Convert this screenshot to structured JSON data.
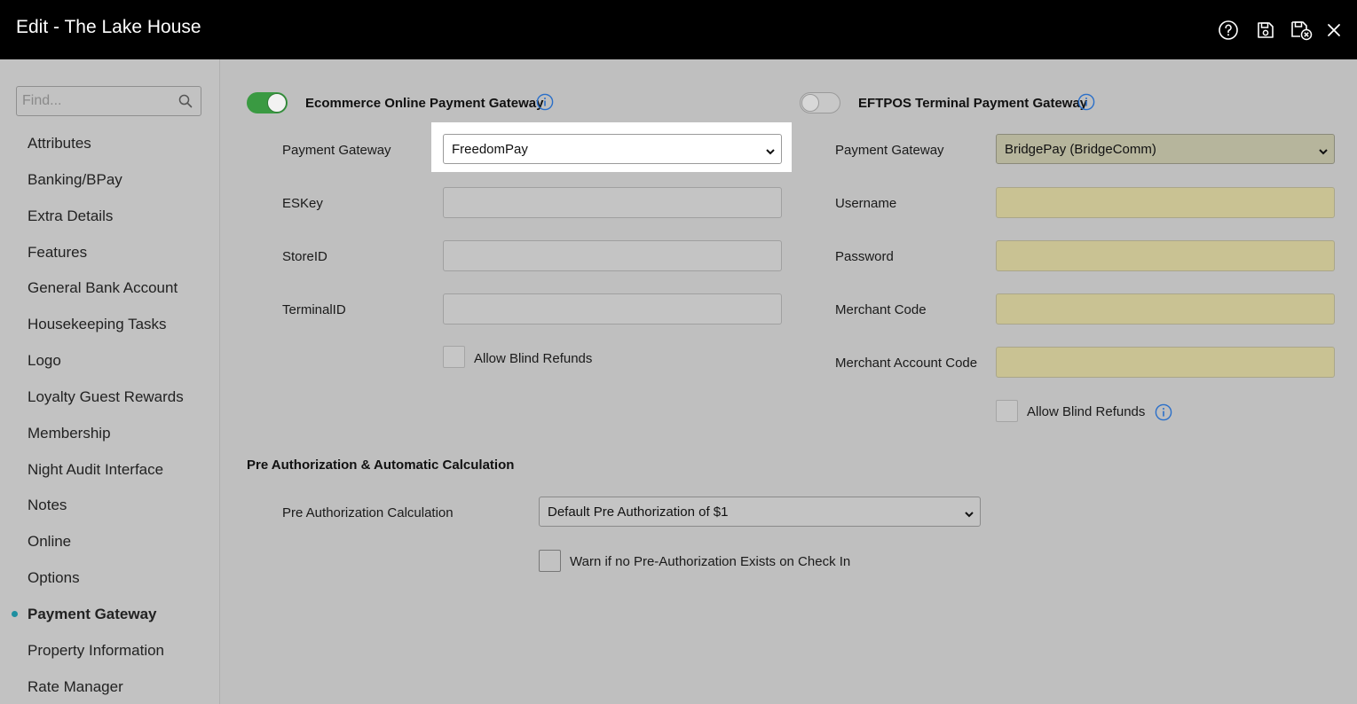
{
  "window": {
    "title": "Edit - The Lake House"
  },
  "titlebar_icons": [
    "help-icon",
    "save-icon",
    "save-close-icon",
    "close-icon"
  ],
  "sidebar": {
    "search_placeholder": "Find...",
    "items": [
      {
        "label": "Attributes",
        "active": false
      },
      {
        "label": "Banking/BPay",
        "active": false
      },
      {
        "label": "Extra Details",
        "active": false
      },
      {
        "label": "Features",
        "active": false
      },
      {
        "label": "General Bank Account",
        "active": false
      },
      {
        "label": "Housekeeping Tasks",
        "active": false
      },
      {
        "label": "Logo",
        "active": false
      },
      {
        "label": "Loyalty Guest Rewards",
        "active": false
      },
      {
        "label": "Membership",
        "active": false
      },
      {
        "label": "Night Audit Interface",
        "active": false
      },
      {
        "label": "Notes",
        "active": false
      },
      {
        "label": "Online",
        "active": false
      },
      {
        "label": "Options",
        "active": false
      },
      {
        "label": "Payment Gateway",
        "active": true
      },
      {
        "label": "Property Information",
        "active": false
      },
      {
        "label": "Rate Manager",
        "active": false
      }
    ]
  },
  "ecommerce": {
    "header": "Ecommerce Online Payment Gateway",
    "enabled": true,
    "gateway_label": "Payment Gateway",
    "gateway_value": "FreedomPay",
    "eskey_label": "ESKey",
    "eskey_value": "",
    "storeid_label": "StoreID",
    "storeid_value": "",
    "terminalid_label": "TerminalID",
    "terminalid_value": "",
    "blind_refunds_label": "Allow Blind Refunds",
    "blind_refunds_checked": false
  },
  "eftpos": {
    "header": "EFTPOS Terminal Payment Gateway",
    "enabled": false,
    "gateway_label": "Payment Gateway",
    "gateway_value": "BridgePay (BridgeComm)",
    "username_label": "Username",
    "password_label": "Password",
    "merchant_code_label": "Merchant Code",
    "merchant_account_code_label": "Merchant Account Code",
    "blind_refunds_label": "Allow Blind Refunds",
    "blind_refunds_checked": false
  },
  "preauth": {
    "header": "Pre Authorization & Automatic Calculation",
    "calc_label": "Pre Authorization Calculation",
    "calc_value": "Default Pre Authorization of $1",
    "warn_label": "Warn if no Pre-Authorization Exists on Check In",
    "warn_checked": false
  },
  "colors": {
    "titlebar": "#000000",
    "toggle_on": "#3a9a42",
    "accent": "#1e8fa0",
    "info_icon": "#2a6fc9",
    "field_required": "#c9c293"
  }
}
